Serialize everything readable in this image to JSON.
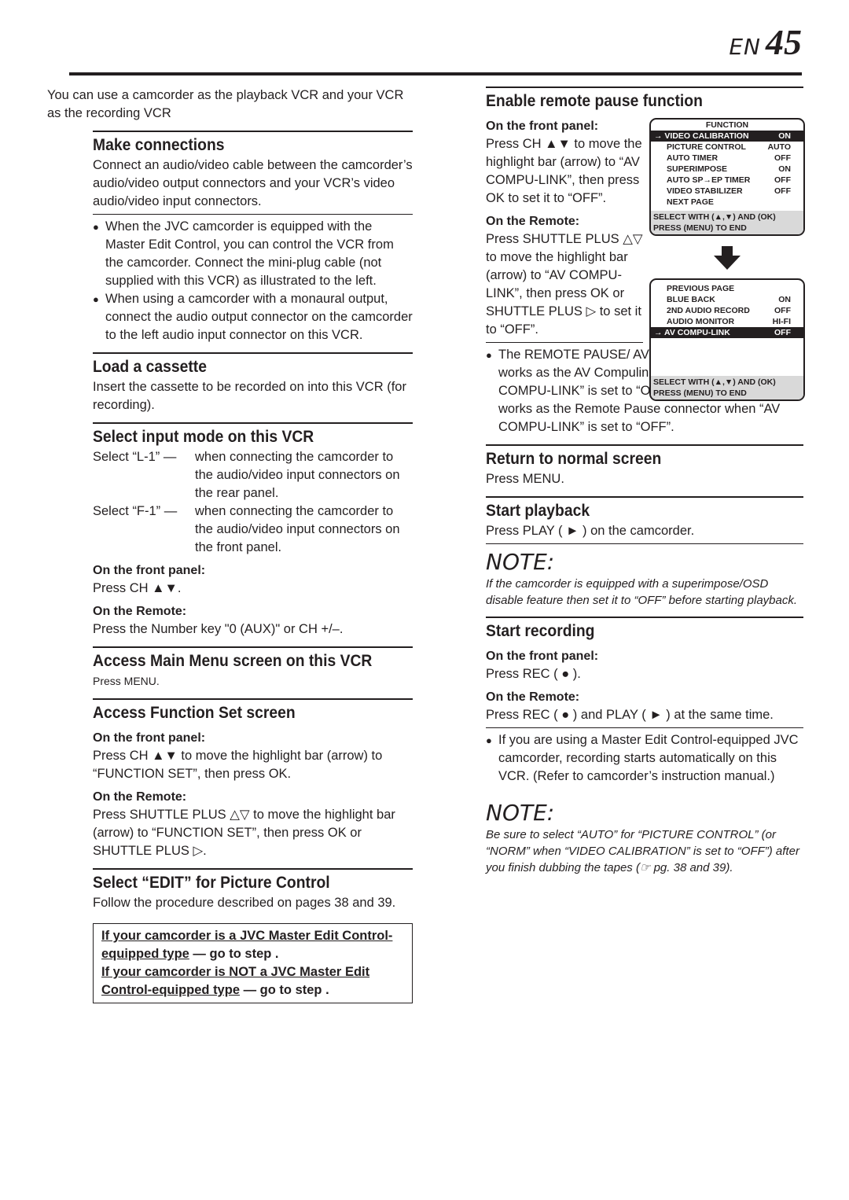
{
  "header": {
    "lang": "EN",
    "page": "45"
  },
  "left": {
    "intro": "You can use a camcorder as the playback VCR and your VCR as the recording VCR",
    "make": {
      "title": "Make connections",
      "body": "Connect an audio/video cable between the camcorder’s audio/video output connectors and your VCR’s video audio/video input connectors.",
      "bullets": [
        "When the JVC camcorder is equipped with the Master Edit Control, you can control the VCR from the camcorder. Connect the mini-plug cable (not supplied with this VCR) as illustrated to the left.",
        "When using a camcorder with a monaural output, connect the audio output connector on the camcorder to the left audio input connector on this VCR."
      ]
    },
    "load": {
      "title": "Load a cassette",
      "body": "Insert the cassette to be recorded on into this VCR (for recording)."
    },
    "input": {
      "title": "Select input mode on this VCR",
      "rows": [
        {
          "k": "Select “L-1” —",
          "v": "when connecting the camcorder to the audio/video input connectors on the rear panel."
        },
        {
          "k": "Select “F-1” —",
          "v": "when connecting the camcorder to the audio/video input connectors on the front panel."
        }
      ],
      "front_label": "On the front panel:",
      "front_text": "Press CH ▲▼.",
      "remote_label": "On the Remote:",
      "remote_text": "Press the Number key \"0 (AUX)\" or CH +/–."
    },
    "main": {
      "title": "Access Main Menu screen on this VCR",
      "body": "Press MENU."
    },
    "func": {
      "title": "Access Function Set screen",
      "front_label": "On the front panel:",
      "front_text": "Press CH ▲▼ to move the highlight bar (arrow) to “FUNCTION SET”, then press OK.",
      "remote_label": "On the Remote:",
      "remote_text": "Press SHUTTLE PLUS △▽ to move the highlight bar (arrow) to “FUNCTION SET”, then press OK or SHUTTLE PLUS ▷."
    },
    "edit": {
      "title": "Select “EDIT” for Picture Control",
      "body": "Follow the procedure described on pages 38 and 39."
    },
    "box": {
      "l1u": "If your camcorder is a JVC Master Edit Control-equipped type",
      "l1": " — go to step   .",
      "l2u": "If your camcorder is NOT a JVC Master Edit Control-equipped type",
      "l2": " — go to step   ."
    }
  },
  "right": {
    "pause": {
      "title": "Enable remote pause function",
      "front_label": "On the front panel:",
      "front_text": "Press CH ▲▼ to move the highlight bar (arrow) to “AV COMPU-LINK”, then press OK to set it to “OFF”.",
      "remote_label": "On the Remote:",
      "remote_text": "Press SHUTTLE PLUS △▽ to move the highlight bar (arrow) to “AV COMPU-LINK”, then press OK or SHUTTLE PLUS ▷ to set it to “OFF”.",
      "bullet": "The REMOTE PAUSE/ AV COMPU-LINK connector works as the AV Compulink connector when “AV COMPU-LINK” is set to “ON” (☞ pg. 38 and 41), and works as the Remote Pause connector when “AV COMPU-LINK” is set to “OFF”."
    },
    "normal": {
      "title": "Return to normal screen",
      "body": "Press MENU."
    },
    "play": {
      "title": "Start playback",
      "body": "Press PLAY ( ► ) on the camcorder."
    },
    "note1": {
      "title": "NOTE:",
      "body": "If the camcorder is equipped with a superimpose/OSD disable feature then set it to “OFF” before starting playback."
    },
    "rec": {
      "title": "Start recording",
      "front_label": "On the front panel:",
      "front_text": "Press REC ( ● ).",
      "remote_label": "On the Remote:",
      "remote_text": "Press REC ( ● ) and PLAY ( ► ) at the same time.",
      "bullet": "If you are using a Master Edit Control-equipped JVC camcorder, recording starts automatically on this VCR. (Refer to camcorder’s instruction manual.)"
    },
    "note2": {
      "title": "NOTE:",
      "body": "Be sure to select “AUTO” for “PICTURE CONTROL” (or “NORM” when “VIDEO CALIBRATION” is set to “OFF”) after you finish dubbing the tapes (☞ pg. 38 and 39)."
    }
  },
  "osd1": {
    "title": "FUNCTION",
    "rows": [
      {
        "k": "→ VIDEO CALIBRATION",
        "v": "ON"
      },
      {
        "k": "PICTURE CONTROL",
        "v": "AUTO"
      },
      {
        "k": "AUTO TIMER",
        "v": "OFF"
      },
      {
        "k": "SUPERIMPOSE",
        "v": "ON"
      },
      {
        "k": "AUTO SP→EP TIMER",
        "v": "OFF"
      },
      {
        "k": "VIDEO STABILIZER",
        "v": "OFF"
      },
      {
        "k": "NEXT PAGE",
        "v": ""
      }
    ],
    "foot1": "SELECT WITH (▲,▼) AND (OK)",
    "foot2": "PRESS (MENU) TO END"
  },
  "osd2": {
    "rows": [
      {
        "k": "PREVIOUS PAGE",
        "v": ""
      },
      {
        "k": "BLUE BACK",
        "v": "ON"
      },
      {
        "k": "2ND AUDIO RECORD",
        "v": "OFF"
      },
      {
        "k": "AUDIO MONITOR",
        "v": "HI-FI"
      },
      {
        "k": "→ AV COMPU-LINK",
        "v": "OFF"
      }
    ],
    "foot1": "SELECT WITH (▲,▼) AND (OK)",
    "foot2": "PRESS (MENU) TO END"
  }
}
